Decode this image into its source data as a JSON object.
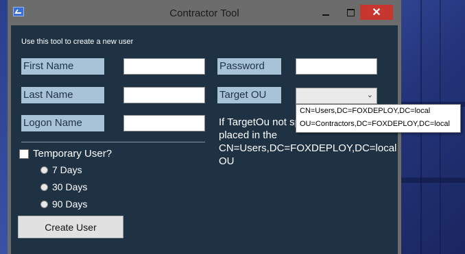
{
  "window": {
    "title": "Contractor Tool",
    "close_glyph": "✕"
  },
  "form": {
    "intro": "Use this tool to create a new user",
    "first_name_label": "First Name",
    "last_name_label": "Last Name",
    "logon_name_label": "Logon Name",
    "password_label": "Password",
    "target_ou_label": "Target OU",
    "first_name_value": "",
    "last_name_value": "",
    "logon_name_value": "",
    "password_value": "",
    "temporary_user_label": "Temporary User?",
    "temporary_user_checked": false,
    "durations": [
      "7 Days",
      "30 Days",
      "90 Days"
    ],
    "create_button": "Create User",
    "info_lines": [
      "If TargetOu not sp",
      "placed in the",
      "CN=Users,DC=FOXDEPLOY,DC=local",
      "OU"
    ]
  },
  "dropdown": {
    "arrow_glyph": "⌄",
    "options": [
      "CN=Users,DC=FOXDEPLOY,DC=local",
      "OU=Contractors,DC=FOXDEPLOY,DC=local"
    ]
  },
  "colors": {
    "client_bg": "#1e3244",
    "label_bg": "#a8c3d8",
    "close_button": "#c7372f"
  }
}
